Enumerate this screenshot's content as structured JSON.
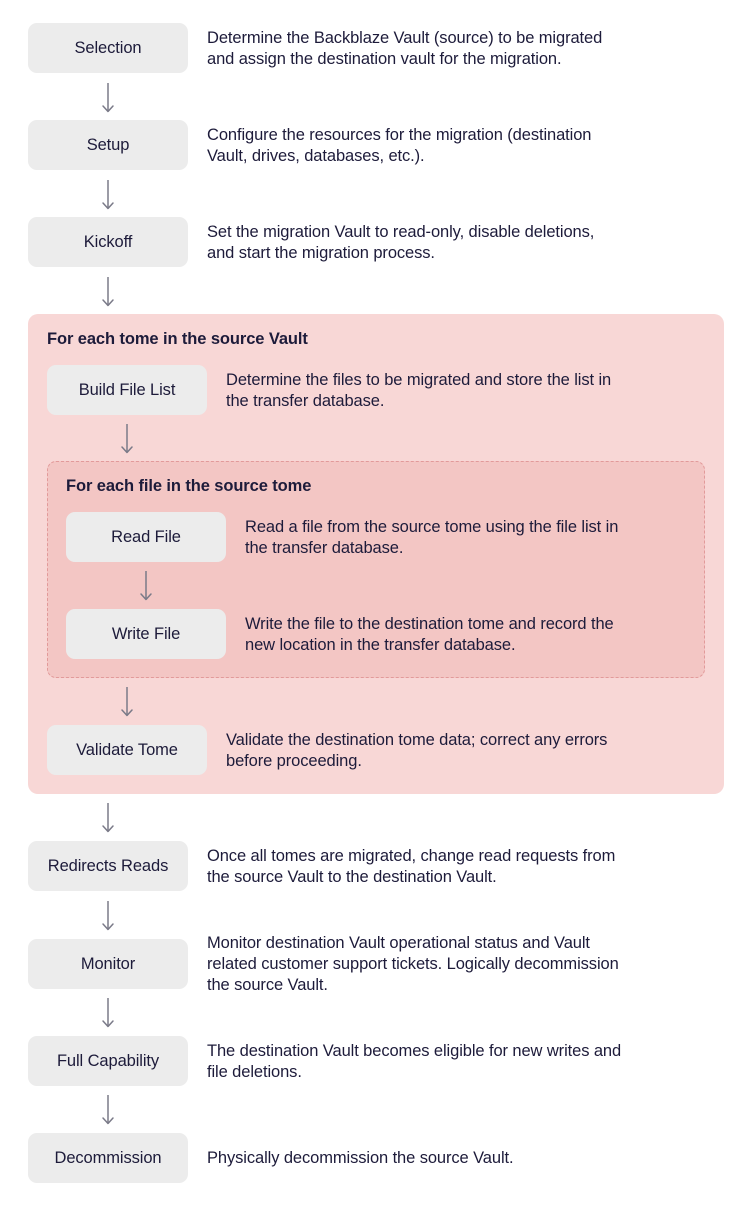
{
  "steps": {
    "selection": {
      "label": "Selection",
      "description": "Determine the Backblaze Vault (source) to be migrated\nand assign the destination vault for the migration."
    },
    "setup": {
      "label": "Setup",
      "description": "Configure the resources for the migration (destination\nVault, drives, databases, etc.)."
    },
    "kickoff": {
      "label": "Kickoff",
      "description": "Set the migration Vault to read-only, disable deletions,\nand start the migration process."
    },
    "build_file_list": {
      "label": "Build File List",
      "description": "Determine the files to be migrated and store the list in\nthe transfer database."
    },
    "read_file": {
      "label": "Read File",
      "description": "Read a file from the source tome using the file list in\nthe transfer database."
    },
    "write_file": {
      "label": "Write File",
      "description": "Write the file to the destination tome and record the\nnew location in the transfer database."
    },
    "validate_tome": {
      "label": "Validate Tome",
      "description": "Validate the destination tome data; correct any errors\nbefore proceeding."
    },
    "redirect_reads": {
      "label": "Redirects Reads",
      "description": "Once all tomes are migrated, change read requests from\nthe source Vault to the destination Vault."
    },
    "monitor": {
      "label": "Monitor",
      "description": "Monitor destination Vault operational status and Vault\nrelated customer support tickets. Logically decommission\nthe source Vault."
    },
    "full_capability": {
      "label": "Full Capability",
      "description": "The destination Vault becomes eligible for new writes and\nfile deletions."
    },
    "decommission": {
      "label": "Decommission",
      "description": "Physically decommission the source Vault."
    }
  },
  "loops": {
    "tome_loop_title": "For each tome in the source Vault",
    "file_loop_title": "For each file in the source tome"
  },
  "colors": {
    "step_box": "#ececec",
    "outer_loop_bg": "#f8d7d6",
    "inner_loop_bg": "#f3c6c4",
    "inner_loop_border": "#e29a9a",
    "text": "#1d1b3a",
    "arrow": "#7a7a88"
  }
}
